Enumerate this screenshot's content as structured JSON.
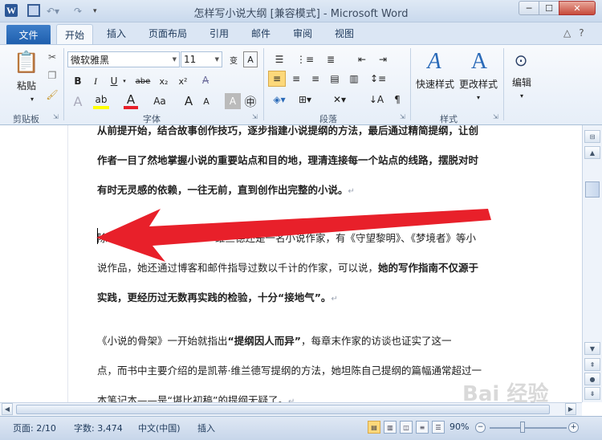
{
  "window": {
    "title": "怎样写小说大纲 [兼容模式] - Microsoft Word",
    "app_icon": "W",
    "min_icon": "─",
    "max_icon": "☐",
    "close_icon": "✕"
  },
  "tabs": {
    "file": "文件",
    "items": [
      "开始",
      "插入",
      "页面布局",
      "引用",
      "邮件",
      "审阅",
      "视图"
    ]
  },
  "ribbon": {
    "clipboard": {
      "paste": "粘贴",
      "label": "剪贴板"
    },
    "font": {
      "name": "微软雅黑",
      "size": "11",
      "wen": "变",
      "label": "字体",
      "row2": [
        "B",
        "I",
        "U",
        "abe",
        "x₂",
        "x²"
      ],
      "row3": [
        "A",
        "A",
        "Aa",
        "A",
        "A",
        "A",
        "㊥"
      ]
    },
    "paragraph": {
      "label": "段落"
    },
    "styles": {
      "quick": "快速样式",
      "change": "更改样式",
      "label": "样式"
    },
    "editing": {
      "edit": "编辑"
    }
  },
  "document": {
    "para1_line1": "从前提开始，结合故事创作技巧，逐步指建小说提纲的方法，最后通过精简提纲，让创",
    "para1_line2": "作者一目了然地掌握小说的重要站点和目的地，理清连接每一个站点的线路，摆脱对时",
    "para1_line3": "有时无灵感的依赖，一往无前，直到创作出完整的小说。",
    "para2_line1_a": "除了",
    "para2_line1_b": "·维兰德还是一名小说作家，有《守望黎明》、《梦境者》等小",
    "para2_line2_a": "说作品，她还通过博客和邮件指导过数以千计的作家，可以说，",
    "para2_line2_b": "她的写作指南不仅源于",
    "para2_line3": "实践，更经历过无数再实践的检验，十分“接地气”。",
    "para3_line1_a": "《小说的骨架》一开始就指出",
    "para3_line1_b": "“提纲因人而异”",
    "para3_line1_c": "，每章末作家的访谈也证实了这一",
    "para3_line2": "点，而书中主要介绍的是凯蒂·维兰德写提纲的方法，她坦陈自己提纲的篇幅通常超过一",
    "para3_line3": "本笔记本——是“堪比初稿”的提纲无疑了。",
    "para_mark": "↵"
  },
  "status": {
    "page": "页面: 2/10",
    "words": "字数: 3,474",
    "lang": "中文(中国)",
    "mode": "插入",
    "zoom": "90%"
  },
  "watermark": "Bai 经验",
  "colors": {
    "accent": "#1f5fae",
    "arrow": "#e8202a"
  }
}
